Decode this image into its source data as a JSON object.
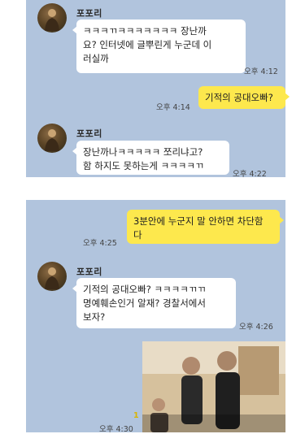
{
  "contact": {
    "name": "포포리"
  },
  "messages": [
    {
      "text": "ㅋㅋㅋㄲㅋㅋㅋㅋㅋㅋㅋ 장난까\n요? 인터넷에 글뿌린게 누군데 이\n러실까",
      "time": "오후 4:12"
    },
    {
      "text": "기적의 공대오빠?",
      "time": "오후 4:14"
    },
    {
      "text": "장난까나ㅋㅋㅋㅋㅋ 쪼리냐고?\n함 하지도 못하는게 ㅋㅋㅋㅋㄲ",
      "time": "오후 4:22"
    },
    {
      "text": "3분안에 누군지 말 안하면 차단함\n다",
      "time": "오후 4:25"
    },
    {
      "text": "기적의 공대오빠? ㅋㅋㅋㅋㄲㄲ\n명예훼손인거 알재? 경찰서에서\n보자?",
      "time": "오후 4:26"
    }
  ],
  "photo_message": {
    "time": "오후 4:30",
    "unread": "1"
  }
}
